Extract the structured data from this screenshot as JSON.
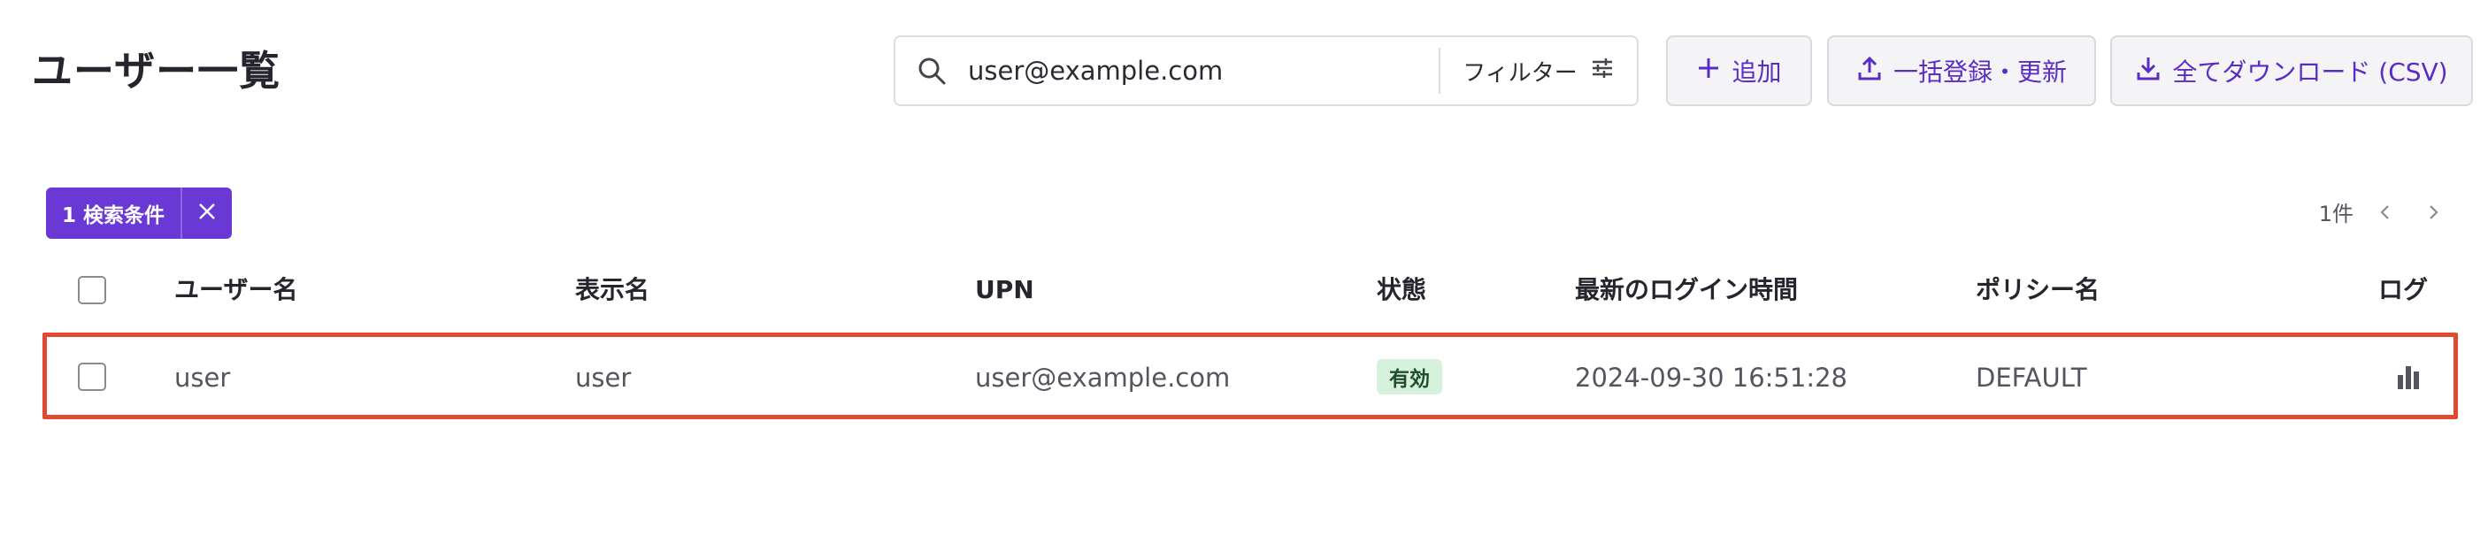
{
  "page": {
    "title": "ユーザー一覧"
  },
  "search": {
    "value": "user@example.com",
    "placeholder": "",
    "filter_label": "フィルター"
  },
  "toolbar": {
    "add_label": "追加",
    "bulk_label": "一括登録・更新",
    "download_label": "全てダウンロード (CSV)"
  },
  "filter_chip": {
    "label": "1 検索条件"
  },
  "pagination": {
    "count": "1件"
  },
  "table": {
    "headers": {
      "username": "ユーザー名",
      "display_name": "表示名",
      "upn": "UPN",
      "status": "状態",
      "last_login": "最新のログイン時間",
      "policy": "ポリシー名",
      "log": "ログ"
    },
    "rows": [
      {
        "username": "user",
        "display_name": "user",
        "upn": "user@example.com",
        "status": "有効",
        "last_login": "2024-09-30 16:51:28",
        "policy": "DEFAULT"
      }
    ]
  },
  "colors": {
    "accent": "#6a38d4",
    "accent_text": "#5a2cc4",
    "status_active_bg": "#d6f2dc",
    "highlight": "#e04a32"
  },
  "icons": [
    "search-icon",
    "filter-sliders-icon",
    "plus-icon",
    "upload-icon",
    "download-icon",
    "close-icon",
    "chevron-left-icon",
    "chevron-right-icon",
    "bar-chart-icon"
  ]
}
